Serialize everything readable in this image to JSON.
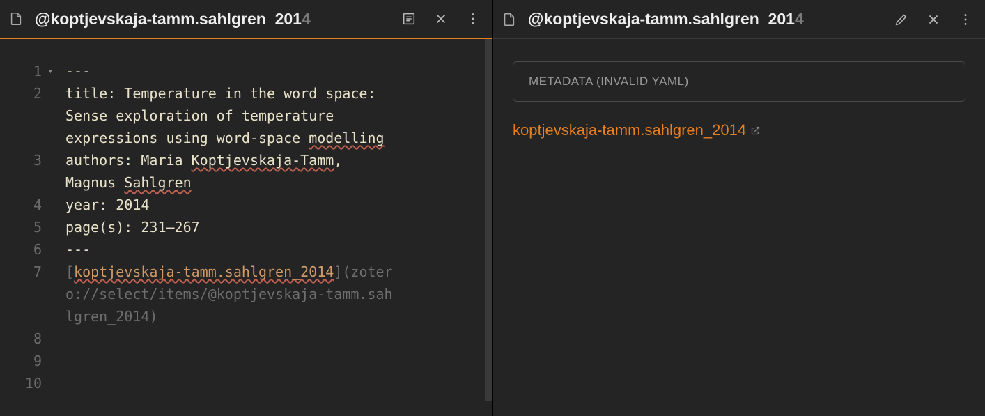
{
  "left": {
    "title_prefix": "@",
    "title_main": "koptjevskaja-tamm.sahlgren_201",
    "title_dim": "4",
    "gutter": [
      "1",
      "2",
      "3",
      "4",
      "5",
      "6",
      "7",
      "8",
      "9",
      "10"
    ],
    "lines": {
      "l1": "---",
      "l2a": "title: Temperature in the word space: ",
      "l2b": "Sense exploration of temperature ",
      "l2c_a": "expressions using word-space ",
      "l2c_b": "modelling",
      "l3a_a": "authors: Maria ",
      "l3a_b": "Koptjevskaja-Tamm",
      "l3a_c": ", ",
      "l3b_a": "Magnus ",
      "l3b_b": "Sahlgren",
      "l4": "year: 2014",
      "l5": "page(s): 231–267",
      "l6": "---",
      "l7_lb": "[",
      "l7_name": "koptjevskaja-tamm.sahlgren_2014",
      "l7_rb": "]",
      "l7_lp": "(",
      "l7_u1": "zoter",
      "l7_u2": "o://select/items/@koptjevskaja-tamm.sah",
      "l7_u3": "lgren_2014",
      "l7_rp": ")"
    }
  },
  "right": {
    "title_prefix": "@",
    "title_main": "koptjevskaja-tamm.sahlgren_201",
    "title_dim": "4",
    "metadata_label": "METADATA (INVALID YAML)",
    "link_text": "koptjevskaja-tamm.sahlgren_2014"
  }
}
